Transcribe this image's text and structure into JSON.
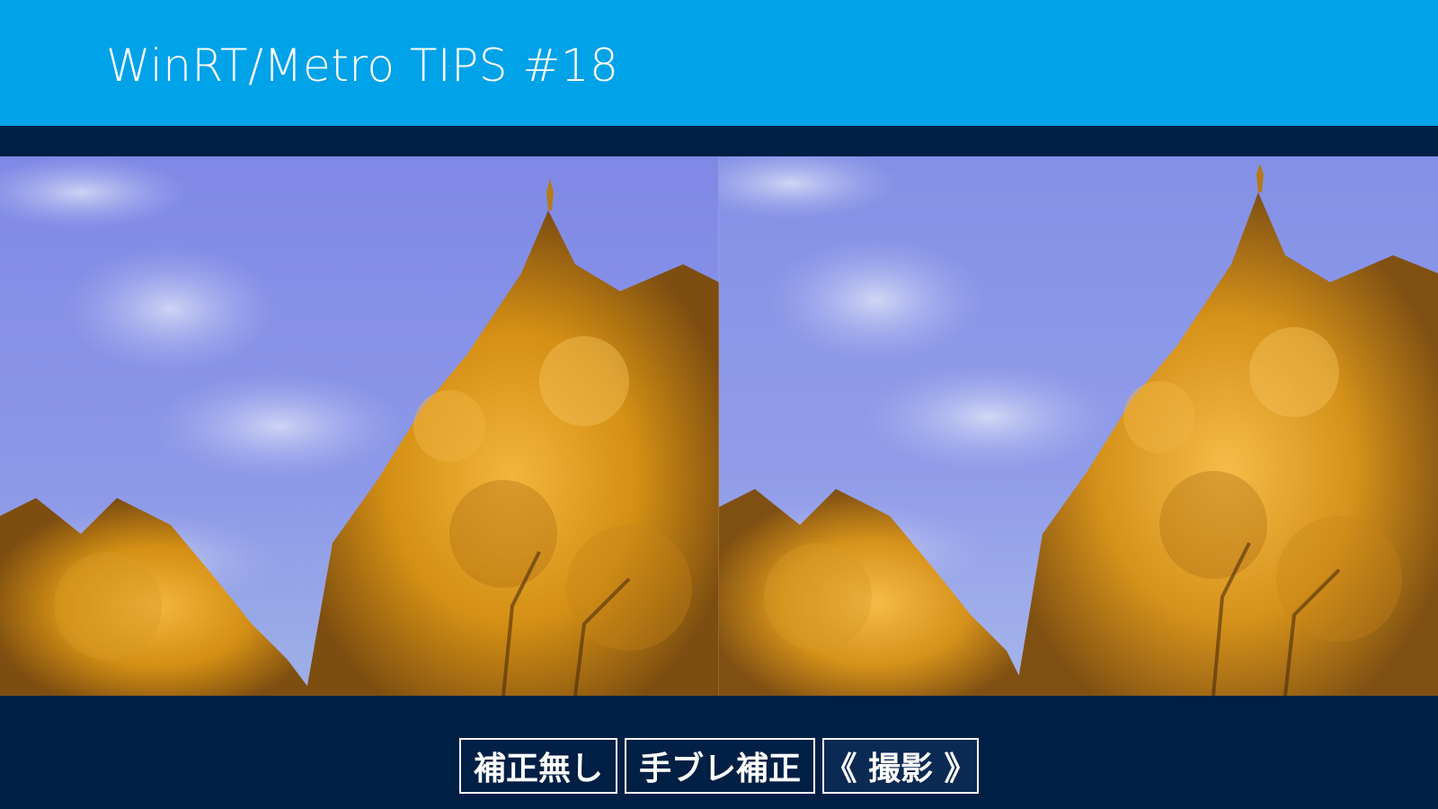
{
  "app": {
    "title": "WinRT/Metro TIPS #18"
  },
  "preview": {
    "left_image": "ginkgo-tree-photo",
    "right_image": "ginkgo-tree-photo"
  },
  "toolbar": {
    "no_correction_label": "補正無し",
    "stabilization_label": "手ブレ補正",
    "capture_label": "《 撮影 》"
  },
  "colors": {
    "header_blue": "#00a2e8",
    "background_navy": "#001f45",
    "text_white": "#ffffff"
  }
}
